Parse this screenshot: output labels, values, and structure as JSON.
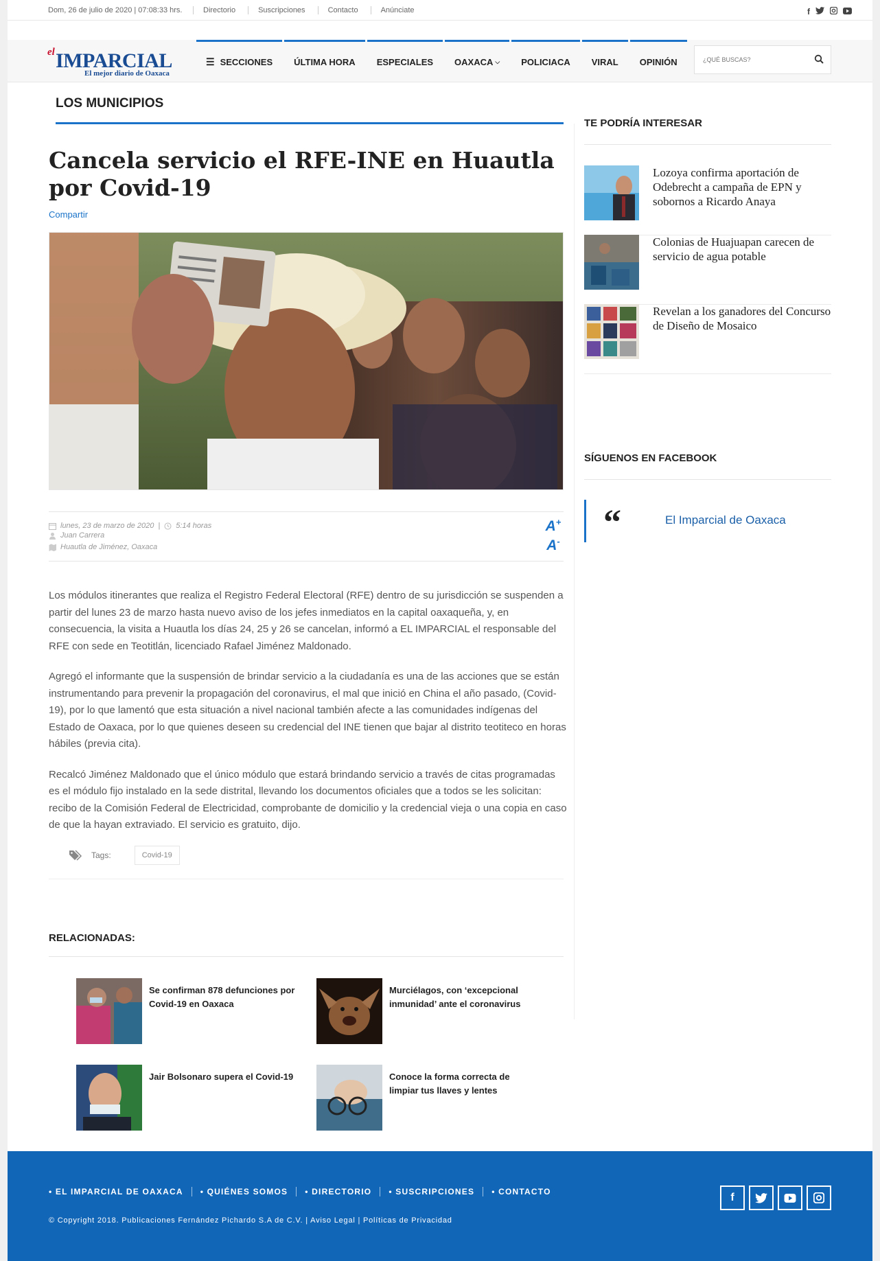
{
  "topbar": {
    "date": "Dom, 26 de julio de 2020 | 07:08:33 hrs.",
    "links": [
      "Directorio",
      "Suscripciones",
      "Contacto",
      "Anúnciate"
    ],
    "social": [
      "facebook-icon",
      "twitter-icon",
      "instagram-icon",
      "youtube-icon"
    ]
  },
  "header": {
    "logo_el": "el",
    "logo_name": "IMPARCIAL",
    "logo_tagline": "El mejor diario de Oaxaca",
    "nav": [
      "SECCIONES",
      "ÚLTIMA HORA",
      "ESPECIALES",
      "OAXACA",
      "POLICIACA",
      "VIRAL",
      "OPINIÓN"
    ],
    "search_placeholder": "¿QUÉ BUSCAS?"
  },
  "article": {
    "section": "LOS MUNICIPIOS",
    "title": "Cancela servicio el RFE-INE en Huautla por Covid-19",
    "share": "Compartir",
    "date": "lunes, 23 de marzo de 2020",
    "time": "5:14 horas",
    "author": "Juan Carrera",
    "location": "Huautla de Jiménez, Oaxaca",
    "paragraphs": [
      "Los módulos itinerantes que realiza el Registro Federal Electoral (RFE) dentro de su jurisdicción se suspenden a partir del lunes 23 de marzo hasta nuevo aviso de los jefes inmediatos en la capital oaxaqueña, y, en consecuencia, la visita a Huautla los días 24, 25 y 26 se cancelan, informó a EL IMPARCIAL el responsable del RFE con sede en Teotitlán, licenciado Rafael Jiménez Maldonado.",
      "Agregó el informante que la suspensión de brindar servicio a la ciudadanía es una de las acciones que se están instrumentando para prevenir la propagación del coronavirus, el mal que inició en China el año pasado, (Covid-19), por lo que lamentó que esta situación a nivel nacional también afecte a las comunidades indígenas del Estado de Oaxaca, por lo que quienes deseen su credencial del INE tienen que bajar al distrito teotiteco en horas hábiles (previa cita).",
      "Recalcó Jiménez Maldonado que el único módulo que estará brindando servicio a través de citas programadas es el módulo fijo instalado en la sede distrital, llevando los documentos oficiales que a todos se les solicitan: recibo de la Comisión Federal de Electricidad, comprobante de domicilio y la credencial vieja o una copia en caso de que la hayan extraviado. El servicio es gratuito, dijo."
    ],
    "tags_label": "Tags:",
    "tags": [
      "Covid-19"
    ]
  },
  "related": {
    "title": "RELACIONADAS:",
    "items": [
      "Se confirman 878 defunciones por Covid-19 en Oaxaca",
      "Murciélagos, con ‘excepcional inmunidad’ ante el coronavirus",
      "Jair Bolsonaro supera el Covid-19",
      "Conoce la forma correcta de limpiar tus llaves y lentes"
    ]
  },
  "sidebar": {
    "interest_title": "TE PODRÍA INTERESAR",
    "interest_items": [
      "Lozoya confirma aportación de Odebrecht a campaña de EPN y sobornos a Ricardo Anaya",
      "Colonias de Huajuapan carecen de servicio de agua potable",
      "Revelan a los ganadores del Concurso de Diseño de Mosaico"
    ],
    "facebook_title": "SÍGUENOS EN FACEBOOK",
    "facebook_quote": "“",
    "facebook_name": "El Imparcial de Oaxaca"
  },
  "footer": {
    "nav": [
      "• EL IMPARCIAL DE OAXACA",
      "• QUIÉNES SOMOS",
      "• DIRECTORIO",
      "• SUSCRIPCIONES",
      "• CONTACTO"
    ],
    "copyright": "© Copyright 2018. Publicaciones Fernández Pichardo S.A de C.V. | Aviso Legal | Políticas de Privacidad",
    "social": [
      "facebook-icon",
      "twitter-icon",
      "youtube-icon",
      "instagram-icon"
    ]
  },
  "colors": {
    "accent": "#1a73c8",
    "footer": "#1266b7",
    "logo_blue": "#1a4c93",
    "logo_red": "#c8102e"
  }
}
